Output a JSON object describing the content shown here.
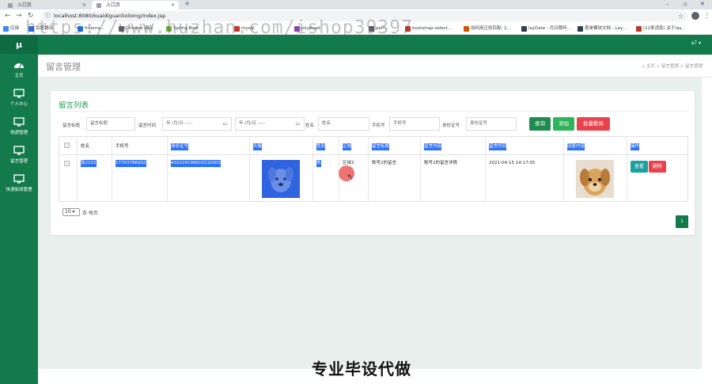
{
  "browser": {
    "tabs": [
      {
        "title": "入口页"
      },
      {
        "title": "入口页"
      }
    ],
    "url": "localhost:8080/kuaidiguanlixitong/index.jsp",
    "bookmarks": [
      {
        "label": "应用",
        "color": "#4285f4"
      },
      {
        "label": "百度翻译",
        "color": "#2b6de0"
      },
      {
        "label": "freema...",
        "color": "#1a73e8"
      },
      {
        "label": "Chrome 商店",
        "color": "#5f6368"
      },
      {
        "label": "Spring Boot",
        "color": "#6db33f"
      },
      {
        "label": "mysql",
        "color": "#c0392b"
      },
      {
        "label": "plupload",
        "color": "#8e44ad"
      },
      {
        "label": "perf...",
        "color": "#5f6368"
      },
      {
        "label": "bootstrap-select...",
        "color": "#c0392b"
      },
      {
        "label": "如何用正则匹配: 2...",
        "color": "#d35400"
      },
      {
        "label": "layDate - 月日期年...",
        "color": "#2c3e50"
      },
      {
        "label": "表单模块文档 - Lay...",
        "color": "#2c3e50"
      },
      {
        "label": "(12条消息) 关于lay...",
        "color": "#c0392b"
      }
    ]
  },
  "app": {
    "logo": "μ",
    "user_menu": "a7 ▾",
    "sidebar": [
      {
        "label": "主页"
      },
      {
        "label": "个人中心"
      },
      {
        "label": "快递管理"
      },
      {
        "label": "留言管理"
      },
      {
        "label": "快递新闻管理"
      }
    ],
    "page_title": "留言管理",
    "breadcrumb": [
      "主页",
      "留言管理",
      "留言管理"
    ]
  },
  "card": {
    "title": "留言列表",
    "filters": {
      "title_label": "留言标题",
      "title_placeholder": "留言标题",
      "time_label": "留言时间",
      "date_from": "年 /月/日 --:--",
      "date_to": "年 /月/日 --:--",
      "name_label": "姓名",
      "name_placeholder": "姓名",
      "phone_label": "手机号",
      "phone_placeholder": "手机号",
      "id_label": "身份证号",
      "id_placeholder": "身份证号"
    },
    "buttons": {
      "search": "查询",
      "add": "添加",
      "batch_delete": "批量删除"
    },
    "columns": [
      "姓名",
      "手机号",
      "身份证号",
      "头像",
      "性别",
      "区域",
      "留言标题",
      "留言内容",
      "留言时间",
      "回复内容",
      "操作"
    ],
    "rows": [
      {
        "name": "张2222",
        "phone": "17703786902",
        "id_number": "410224199610232002",
        "gender": "男",
        "region": "区域3",
        "msg_title": "账号2的留言",
        "msg_content": "账号2的留言详情",
        "msg_time": "2021-04-15 14:17:05",
        "action_view": "查看",
        "action_delete": "删除"
      }
    ],
    "pager": {
      "page_size": "10",
      "per_page_label": "条 每页",
      "current_page": "1"
    }
  },
  "watermark": "https://www.huzhan.com/ishop39397",
  "banner": "专业毕设代做",
  "colors": {
    "primary": "#127a4b",
    "accent_green": "#28a05a",
    "search_btn": "#1e8c4e",
    "add_btn": "#2fb45a",
    "danger": "#e8424d",
    "view_btn": "#1aa0a0",
    "selection": "#2f72f5"
  }
}
